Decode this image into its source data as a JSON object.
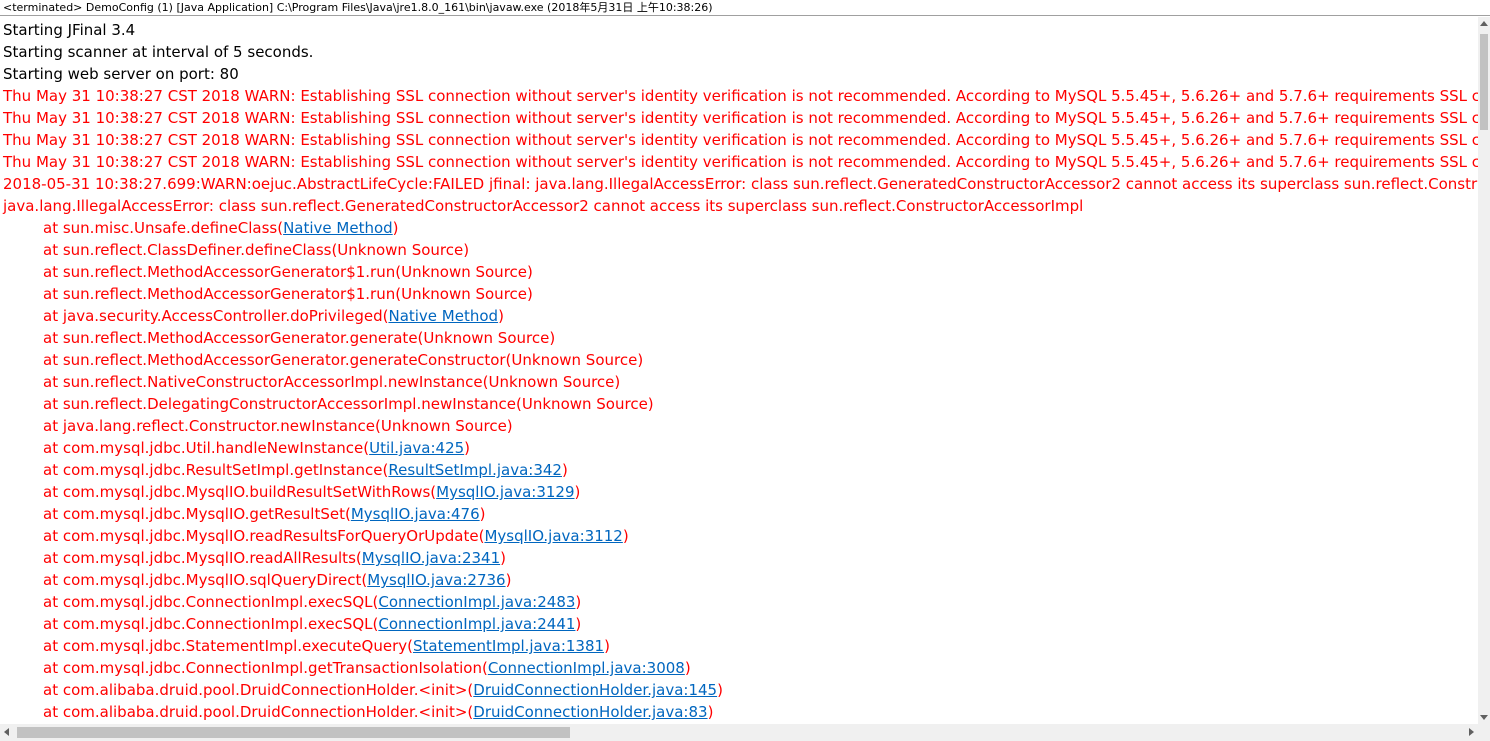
{
  "console": {
    "title": "<terminated> DemoConfig (1) [Java Application] C:\\Program Files\\Java\\jre1.8.0_161\\bin\\javaw.exe (2018年5月31日 上午10:38:26)",
    "lines": [
      {
        "kind": "out",
        "text": "Starting JFinal 3.4"
      },
      {
        "kind": "out",
        "text": "Starting scanner at interval of 5 seconds."
      },
      {
        "kind": "out",
        "text": "Starting web server on port: 80"
      },
      {
        "kind": "err",
        "text": "Thu May 31 10:38:27 CST 2018 WARN: Establishing SSL connection without server's identity verification is not recommended. According to MySQL 5.5.45+, 5.6.26+ and 5.7.6+ requirements SSL co"
      },
      {
        "kind": "err",
        "text": "Thu May 31 10:38:27 CST 2018 WARN: Establishing SSL connection without server's identity verification is not recommended. According to MySQL 5.5.45+, 5.6.26+ and 5.7.6+ requirements SSL co"
      },
      {
        "kind": "err",
        "text": "Thu May 31 10:38:27 CST 2018 WARN: Establishing SSL connection without server's identity verification is not recommended. According to MySQL 5.5.45+, 5.6.26+ and 5.7.6+ requirements SSL co"
      },
      {
        "kind": "err",
        "text": "Thu May 31 10:38:27 CST 2018 WARN: Establishing SSL connection without server's identity verification is not recommended. According to MySQL 5.5.45+, 5.6.26+ and 5.7.6+ requirements SSL co"
      },
      {
        "kind": "err",
        "text": "2018-05-31 10:38:27.699:WARN:oejuc.AbstractLifeCycle:FAILED jfinal: java.lang.IllegalAccessError: class sun.reflect.GeneratedConstructorAccessor2 cannot access its superclass sun.reflect.Construct"
      },
      {
        "kind": "err",
        "text": "java.lang.IllegalAccessError: class sun.reflect.GeneratedConstructorAccessor2 cannot access its superclass sun.reflect.ConstructorAccessorImpl"
      },
      {
        "kind": "trace",
        "pre": "at sun.misc.Unsafe.defineClass(",
        "link": "Native Method",
        "post": ")"
      },
      {
        "kind": "trace",
        "pre": "at sun.reflect.ClassDefiner.defineClass(Unknown Source)",
        "link": "",
        "post": ""
      },
      {
        "kind": "trace",
        "pre": "at sun.reflect.MethodAccessorGenerator$1.run(Unknown Source)",
        "link": "",
        "post": ""
      },
      {
        "kind": "trace",
        "pre": "at sun.reflect.MethodAccessorGenerator$1.run(Unknown Source)",
        "link": "",
        "post": ""
      },
      {
        "kind": "trace",
        "pre": "at java.security.AccessController.doPrivileged(",
        "link": "Native Method",
        "post": ")"
      },
      {
        "kind": "trace",
        "pre": "at sun.reflect.MethodAccessorGenerator.generate(Unknown Source)",
        "link": "",
        "post": ""
      },
      {
        "kind": "trace",
        "pre": "at sun.reflect.MethodAccessorGenerator.generateConstructor(Unknown Source)",
        "link": "",
        "post": ""
      },
      {
        "kind": "trace",
        "pre": "at sun.reflect.NativeConstructorAccessorImpl.newInstance(Unknown Source)",
        "link": "",
        "post": ""
      },
      {
        "kind": "trace",
        "pre": "at sun.reflect.DelegatingConstructorAccessorImpl.newInstance(Unknown Source)",
        "link": "",
        "post": ""
      },
      {
        "kind": "trace",
        "pre": "at java.lang.reflect.Constructor.newInstance(Unknown Source)",
        "link": "",
        "post": ""
      },
      {
        "kind": "trace",
        "pre": "at com.mysql.jdbc.Util.handleNewInstance(",
        "link": "Util.java:425",
        "post": ")"
      },
      {
        "kind": "trace",
        "pre": "at com.mysql.jdbc.ResultSetImpl.getInstance(",
        "link": "ResultSetImpl.java:342",
        "post": ")"
      },
      {
        "kind": "trace",
        "pre": "at com.mysql.jdbc.MysqlIO.buildResultSetWithRows(",
        "link": "MysqlIO.java:3129",
        "post": ")"
      },
      {
        "kind": "trace",
        "pre": "at com.mysql.jdbc.MysqlIO.getResultSet(",
        "link": "MysqlIO.java:476",
        "post": ")"
      },
      {
        "kind": "trace",
        "pre": "at com.mysql.jdbc.MysqlIO.readResultsForQueryOrUpdate(",
        "link": "MysqlIO.java:3112",
        "post": ")"
      },
      {
        "kind": "trace",
        "pre": "at com.mysql.jdbc.MysqlIO.readAllResults(",
        "link": "MysqlIO.java:2341",
        "post": ")"
      },
      {
        "kind": "trace",
        "pre": "at com.mysql.jdbc.MysqlIO.sqlQueryDirect(",
        "link": "MysqlIO.java:2736",
        "post": ")"
      },
      {
        "kind": "trace",
        "pre": "at com.mysql.jdbc.ConnectionImpl.execSQL(",
        "link": "ConnectionImpl.java:2483",
        "post": ")"
      },
      {
        "kind": "trace",
        "pre": "at com.mysql.jdbc.ConnectionImpl.execSQL(",
        "link": "ConnectionImpl.java:2441",
        "post": ")"
      },
      {
        "kind": "trace",
        "pre": "at com.mysql.jdbc.StatementImpl.executeQuery(",
        "link": "StatementImpl.java:1381",
        "post": ")"
      },
      {
        "kind": "trace",
        "pre": "at com.mysql.jdbc.ConnectionImpl.getTransactionIsolation(",
        "link": "ConnectionImpl.java:3008",
        "post": ")"
      },
      {
        "kind": "trace",
        "pre": "at com.alibaba.druid.pool.DruidConnectionHolder.<init>(",
        "link": "DruidConnectionHolder.java:145",
        "post": ")"
      },
      {
        "kind": "trace",
        "pre": "at com.alibaba.druid.pool.DruidConnectionHolder.<init>(",
        "link": "DruidConnectionHolder.java:83",
        "post": ")"
      }
    ]
  },
  "colors": {
    "stdout": "#000000",
    "stderr": "#ff0000",
    "link": "#0066bf"
  }
}
